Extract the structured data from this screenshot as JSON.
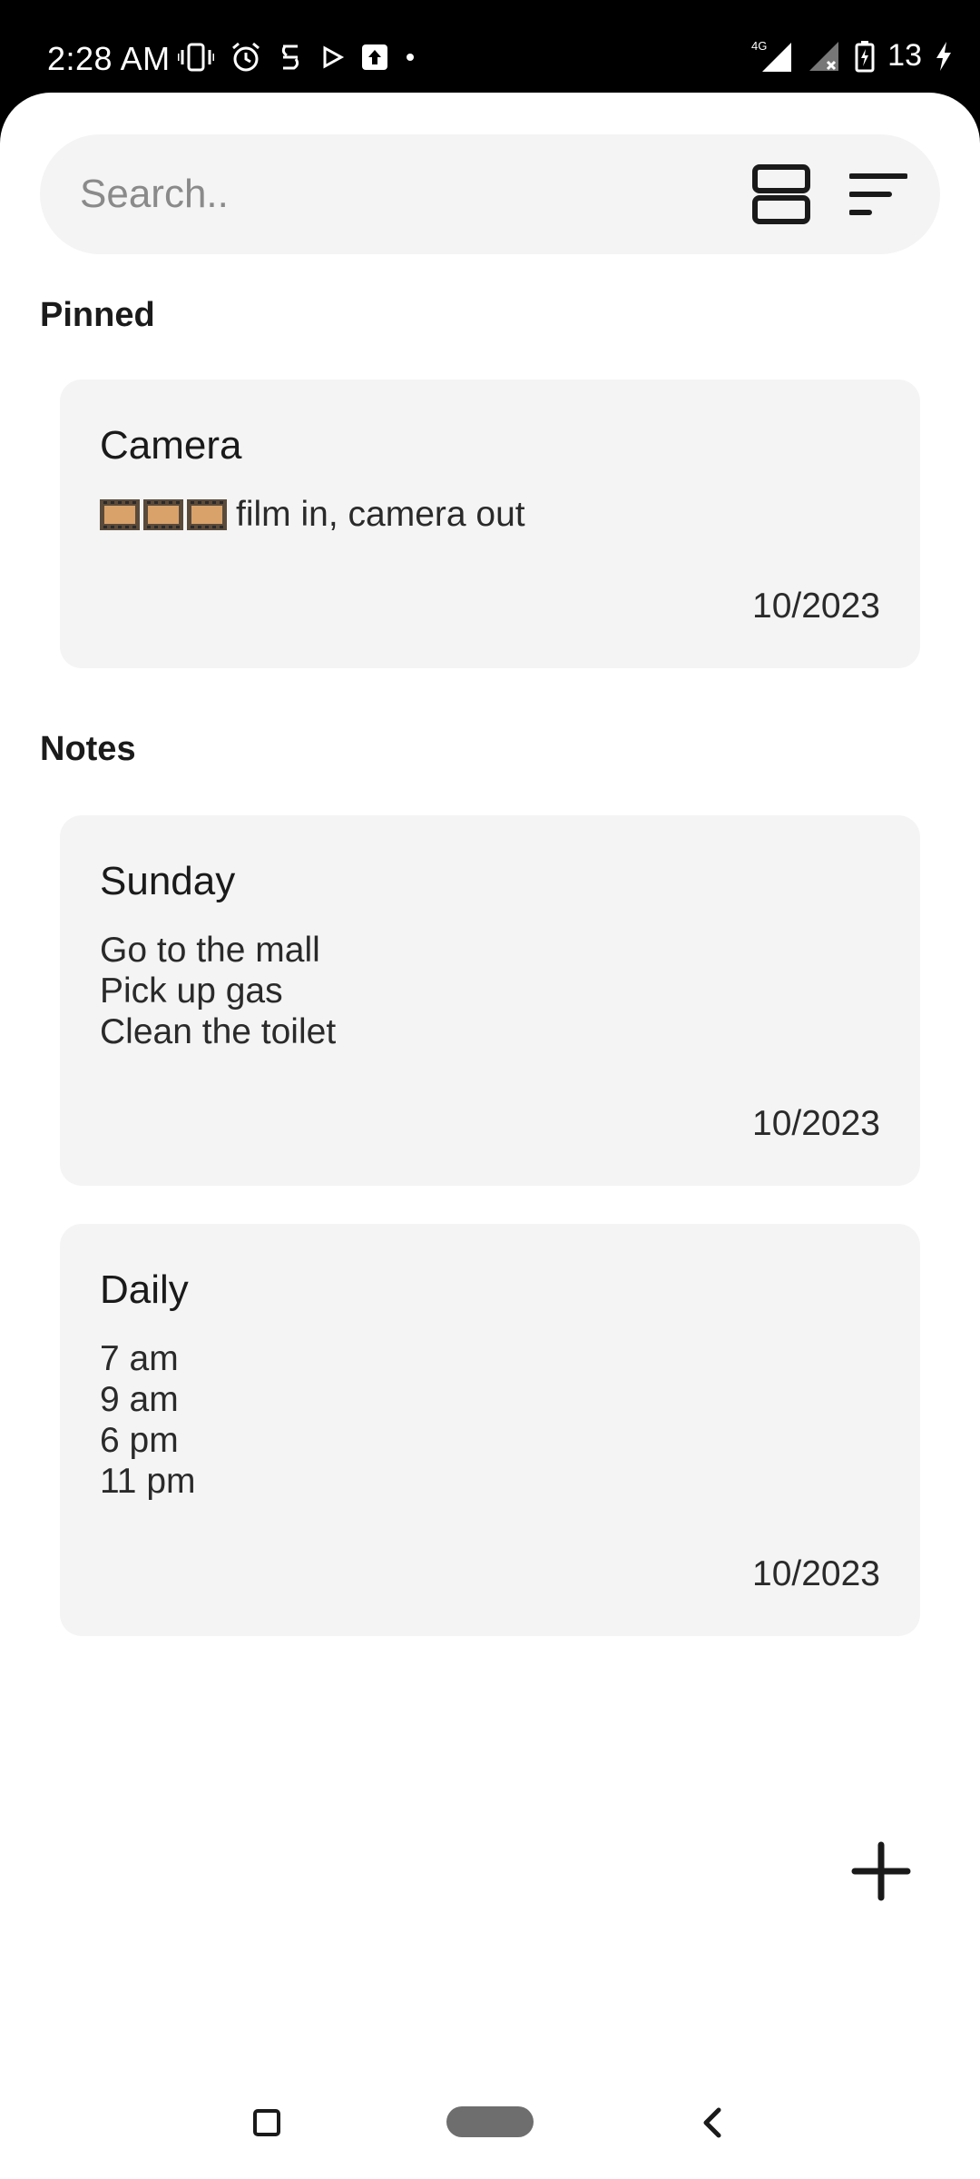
{
  "status_bar": {
    "time": "2:28 AM",
    "network": "4G",
    "battery": "13",
    "left_icons": [
      "vibrate-icon",
      "alarm-icon",
      "app-notification-icon",
      "play-store-icon",
      "upload-icon",
      "more-dot-icon"
    ],
    "right_icons": [
      "signal-icon",
      "no-signal-icon",
      "battery-charging-icon",
      "charging-bolt-icon"
    ]
  },
  "search": {
    "placeholder": "Search.."
  },
  "toolbar": {
    "layout_icon": "view-agenda-icon",
    "sort_icon": "sort-icon"
  },
  "sections": {
    "pinned_label": "Pinned",
    "notes_label": "Notes"
  },
  "pinned_notes": [
    {
      "title": "Camera",
      "body": "film in, camera out",
      "body_prefix_icon": "film-frames-icon",
      "date": "10/2023"
    }
  ],
  "notes": [
    {
      "title": "Sunday",
      "body": "Go to the mall\nPick up gas\nClean the toilet",
      "date": "10/2023"
    },
    {
      "title": "Daily",
      "body": "7 am\n9 am\n6 pm\n11 pm",
      "date": "10/2023"
    }
  ],
  "fab": {
    "icon": "plus-icon"
  },
  "nav": {
    "recents": "recents-icon",
    "home": "home-pill-icon",
    "back": "back-icon"
  },
  "colors": {
    "card_bg": "#f4f4f4",
    "text": "#1a1a1a",
    "status_bar_bg": "#000000"
  }
}
